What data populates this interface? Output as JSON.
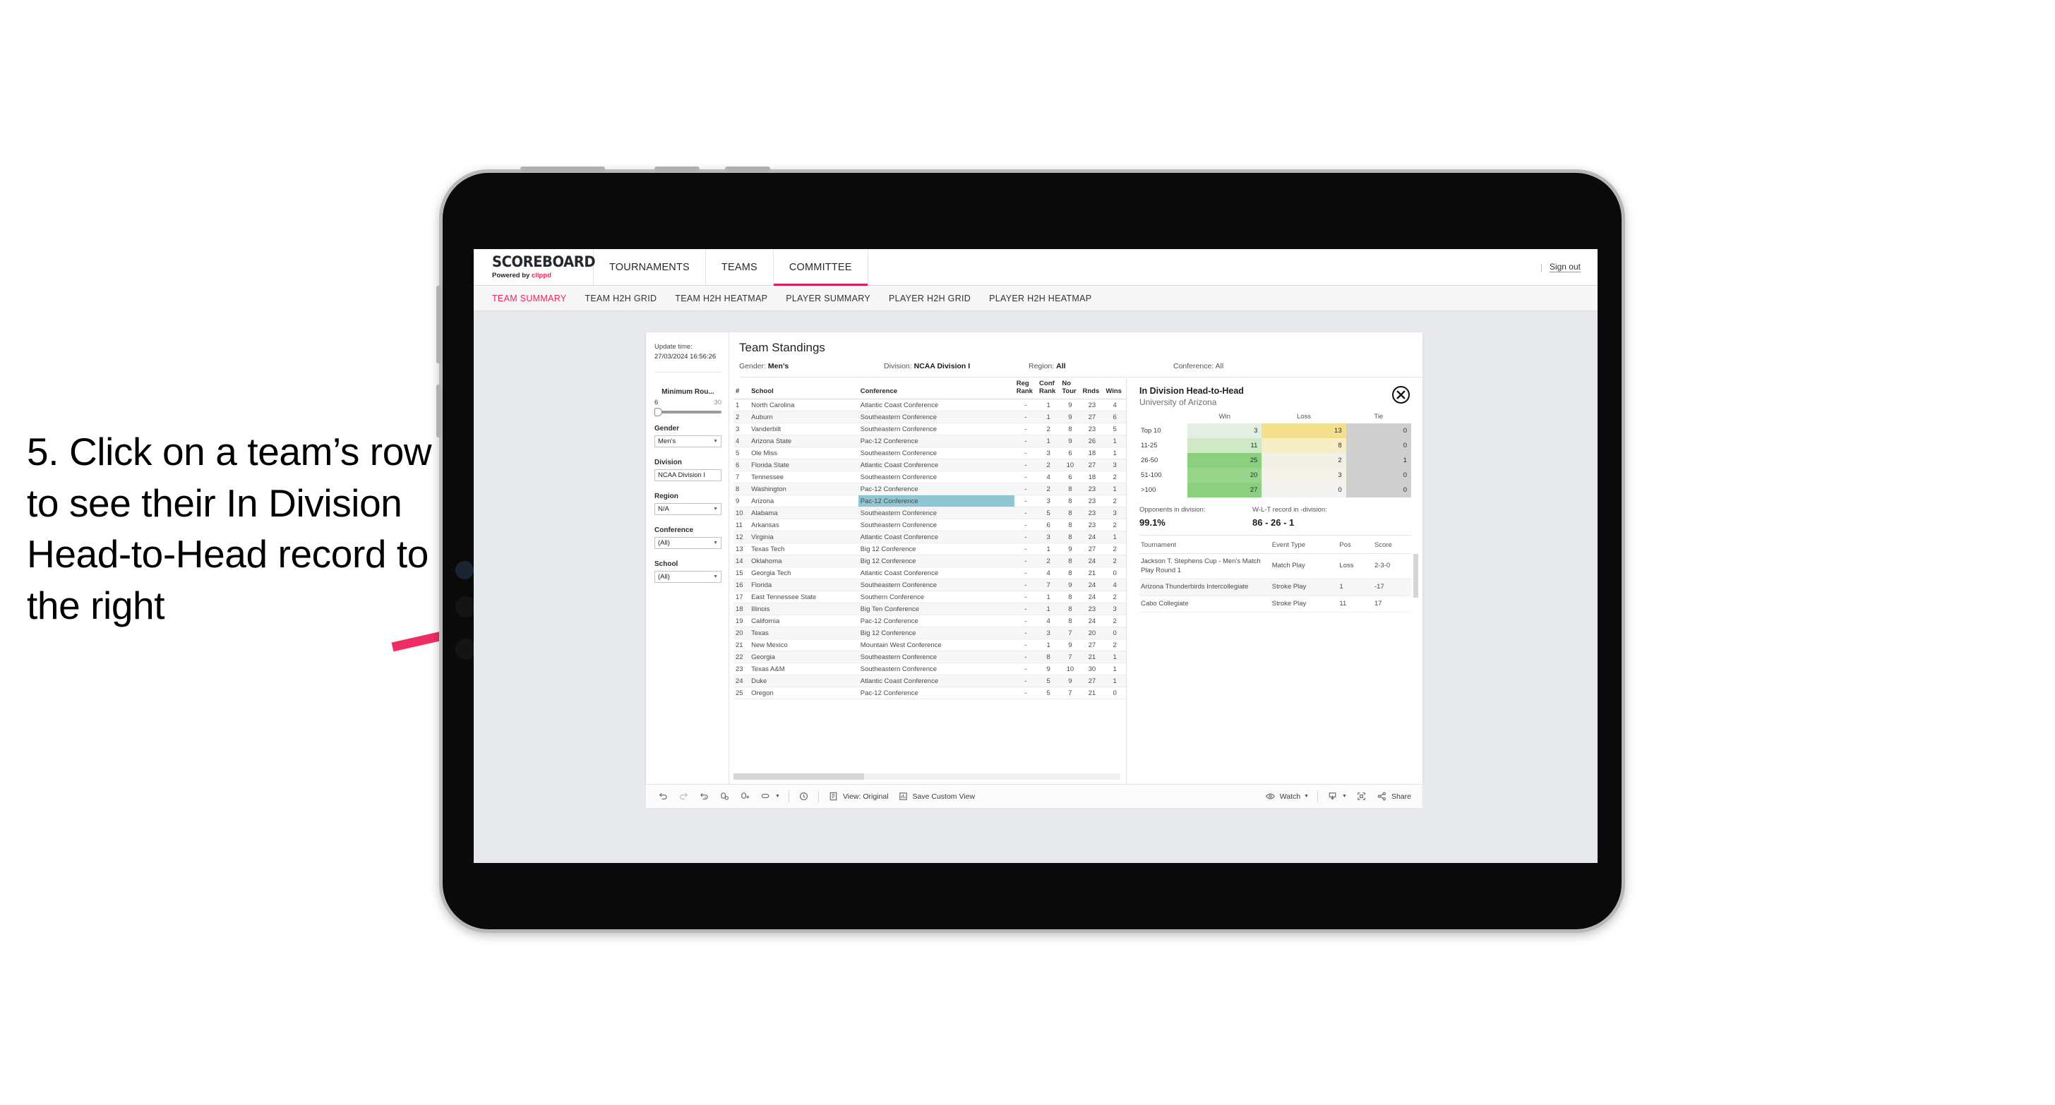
{
  "annotation": {
    "text": "5. Click on a team’s row to see their In Division Head-to-Head record to the right",
    "arrow_color": "#ef2d63"
  },
  "topnav": {
    "logo_main": "SCOREBOARD",
    "logo_sub_prefix": "Powered by ",
    "logo_sub_brand": "clippd",
    "items": [
      {
        "label": "TOURNAMENTS",
        "active": false
      },
      {
        "label": "TEAMS",
        "active": false
      },
      {
        "label": "COMMITTEE",
        "active": true
      }
    ],
    "divider": "|",
    "sign_out": "Sign out"
  },
  "subtabs": [
    {
      "label": "TEAM SUMMARY",
      "active": true
    },
    {
      "label": "TEAM H2H GRID",
      "active": false
    },
    {
      "label": "TEAM H2H HEATMAP",
      "active": false
    },
    {
      "label": "PLAYER SUMMARY",
      "active": false
    },
    {
      "label": "PLAYER H2H GRID",
      "active": false
    },
    {
      "label": "PLAYER H2H HEATMAP",
      "active": false
    }
  ],
  "filters": {
    "update_label": "Update time:",
    "update_value": "27/03/2024 16:56:26",
    "slider": {
      "title": "Minimum Rou...",
      "low": "6",
      "high": "30"
    },
    "groups": [
      {
        "label": "Gender",
        "value": "Men’s"
      },
      {
        "label": "Division",
        "value": "NCAA Division I"
      },
      {
        "label": "Region",
        "value": "N/A"
      },
      {
        "label": "Conference",
        "value": "(All)"
      },
      {
        "label": "School",
        "value": "(All)"
      }
    ]
  },
  "standings": {
    "title": "Team Standings",
    "meta": [
      {
        "key": "Gender:",
        "value": "Men’s"
      },
      {
        "key": "Division:",
        "value": "NCAA Division I"
      },
      {
        "key": "Region:",
        "value": "All"
      },
      {
        "key": "Conference:",
        "value": "All"
      }
    ],
    "columns": [
      "#",
      "School",
      "Conference",
      "Reg Rank",
      "Conf Rank",
      "No Tour",
      "Rnds",
      "Wins"
    ],
    "rows": [
      [
        "1",
        "North Carolina",
        "Atlantic Coast Conference",
        "-",
        "1",
        "9",
        "23",
        "4"
      ],
      [
        "2",
        "Auburn",
        "Southeastern Conference",
        "-",
        "1",
        "9",
        "27",
        "6"
      ],
      [
        "3",
        "Vanderbilt",
        "Southeastern Conference",
        "-",
        "2",
        "8",
        "23",
        "5"
      ],
      [
        "4",
        "Arizona State",
        "Pac-12 Conference",
        "-",
        "1",
        "9",
        "26",
        "1"
      ],
      [
        "5",
        "Ole Miss",
        "Southeastern Conference",
        "-",
        "3",
        "6",
        "18",
        "1"
      ],
      [
        "6",
        "Florida State",
        "Atlantic Coast Conference",
        "-",
        "2",
        "10",
        "27",
        "3"
      ],
      [
        "7",
        "Tennessee",
        "Southeastern Conference",
        "-",
        "4",
        "6",
        "18",
        "2"
      ],
      [
        "8",
        "Washington",
        "Pac-12 Conference",
        "-",
        "2",
        "8",
        "23",
        "1"
      ],
      [
        "9",
        "Arizona",
        "Pac-12 Conference",
        "-",
        "3",
        "8",
        "23",
        "2"
      ],
      [
        "10",
        "Alabama",
        "Southeastern Conference",
        "-",
        "5",
        "8",
        "23",
        "3"
      ],
      [
        "11",
        "Arkansas",
        "Southeastern Conference",
        "-",
        "6",
        "8",
        "23",
        "2"
      ],
      [
        "12",
        "Virginia",
        "Atlantic Coast Conference",
        "-",
        "3",
        "8",
        "24",
        "1"
      ],
      [
        "13",
        "Texas Tech",
        "Big 12 Conference",
        "-",
        "1",
        "9",
        "27",
        "2"
      ],
      [
        "14",
        "Oklahoma",
        "Big 12 Conference",
        "-",
        "2",
        "8",
        "24",
        "2"
      ],
      [
        "15",
        "Georgia Tech",
        "Atlantic Coast Conference",
        "-",
        "4",
        "8",
        "21",
        "0"
      ],
      [
        "16",
        "Florida",
        "Southeastern Conference",
        "-",
        "7",
        "9",
        "24",
        "4"
      ],
      [
        "17",
        "East Tennessee State",
        "Southern Conference",
        "-",
        "1",
        "8",
        "24",
        "2"
      ],
      [
        "18",
        "Illinois",
        "Big Ten Conference",
        "-",
        "1",
        "8",
        "23",
        "3"
      ],
      [
        "19",
        "California",
        "Pac-12 Conference",
        "-",
        "4",
        "8",
        "24",
        "2"
      ],
      [
        "20",
        "Texas",
        "Big 12 Conference",
        "-",
        "3",
        "7",
        "20",
        "0"
      ],
      [
        "21",
        "New Mexico",
        "Mountain West Conference",
        "-",
        "1",
        "9",
        "27",
        "2"
      ],
      [
        "22",
        "Georgia",
        "Southeastern Conference",
        "-",
        "8",
        "7",
        "21",
        "1"
      ],
      [
        "23",
        "Texas A&M",
        "Southeastern Conference",
        "-",
        "9",
        "10",
        "30",
        "1"
      ],
      [
        "24",
        "Duke",
        "Atlantic Coast Conference",
        "-",
        "5",
        "9",
        "27",
        "1"
      ],
      [
        "25",
        "Oregon",
        "Pac-12 Conference",
        "-",
        "5",
        "7",
        "21",
        "0"
      ]
    ],
    "selected_row_index": 8
  },
  "h2h": {
    "title": "In Division Head-to-Head",
    "subtitle": "University of Arizona",
    "close_icon": "close-icon",
    "chart_data": {
      "type": "heatmap",
      "title": "In Division Head-to-Head",
      "columns": [
        "Win",
        "Loss",
        "Tie"
      ],
      "rows": [
        "Top 10",
        "11-25",
        "26-50",
        "51-100",
        ">100"
      ],
      "values": [
        [
          3,
          13,
          0
        ],
        [
          11,
          8,
          0
        ],
        [
          25,
          2,
          1
        ],
        [
          20,
          3,
          0
        ],
        [
          27,
          0,
          0
        ]
      ],
      "cell_colors": [
        [
          "#e2efe2",
          "#f2e08d",
          "#cfcfcf"
        ],
        [
          "#cfe8c5",
          "#f6ecc6",
          "#cfcfcf"
        ],
        [
          "#8bd07e",
          "#f2f0e6",
          "#cfcfcf"
        ],
        [
          "#97d68a",
          "#f4f2e9",
          "#cfcfcf"
        ],
        [
          "#8bd07e",
          "#f2f2f0",
          "#cfcfcf"
        ]
      ]
    },
    "stats": [
      {
        "key": "Opponents in division:",
        "value": "99.1%"
      },
      {
        "key": "W-L-T record in -division:",
        "value": "86 - 26 - 1"
      }
    ],
    "tournament_columns": [
      "Tournament",
      "Event Type",
      "Pos",
      "Score"
    ],
    "tournament_rows": [
      [
        "Jackson T. Stephens Cup - Men’s Match Play Round 1",
        "Match Play",
        "Loss",
        "2-3-0"
      ],
      [
        "Arizona Thunderbirds Intercollegiate",
        "Stroke Play",
        "1",
        "-17"
      ],
      [
        "Cabo Collegiate",
        "Stroke Play",
        "11",
        "17"
      ]
    ]
  },
  "toolbar": {
    "view_label": "View: Original",
    "save_label": "Save Custom View",
    "watch_label": "Watch",
    "share_label": "Share"
  }
}
